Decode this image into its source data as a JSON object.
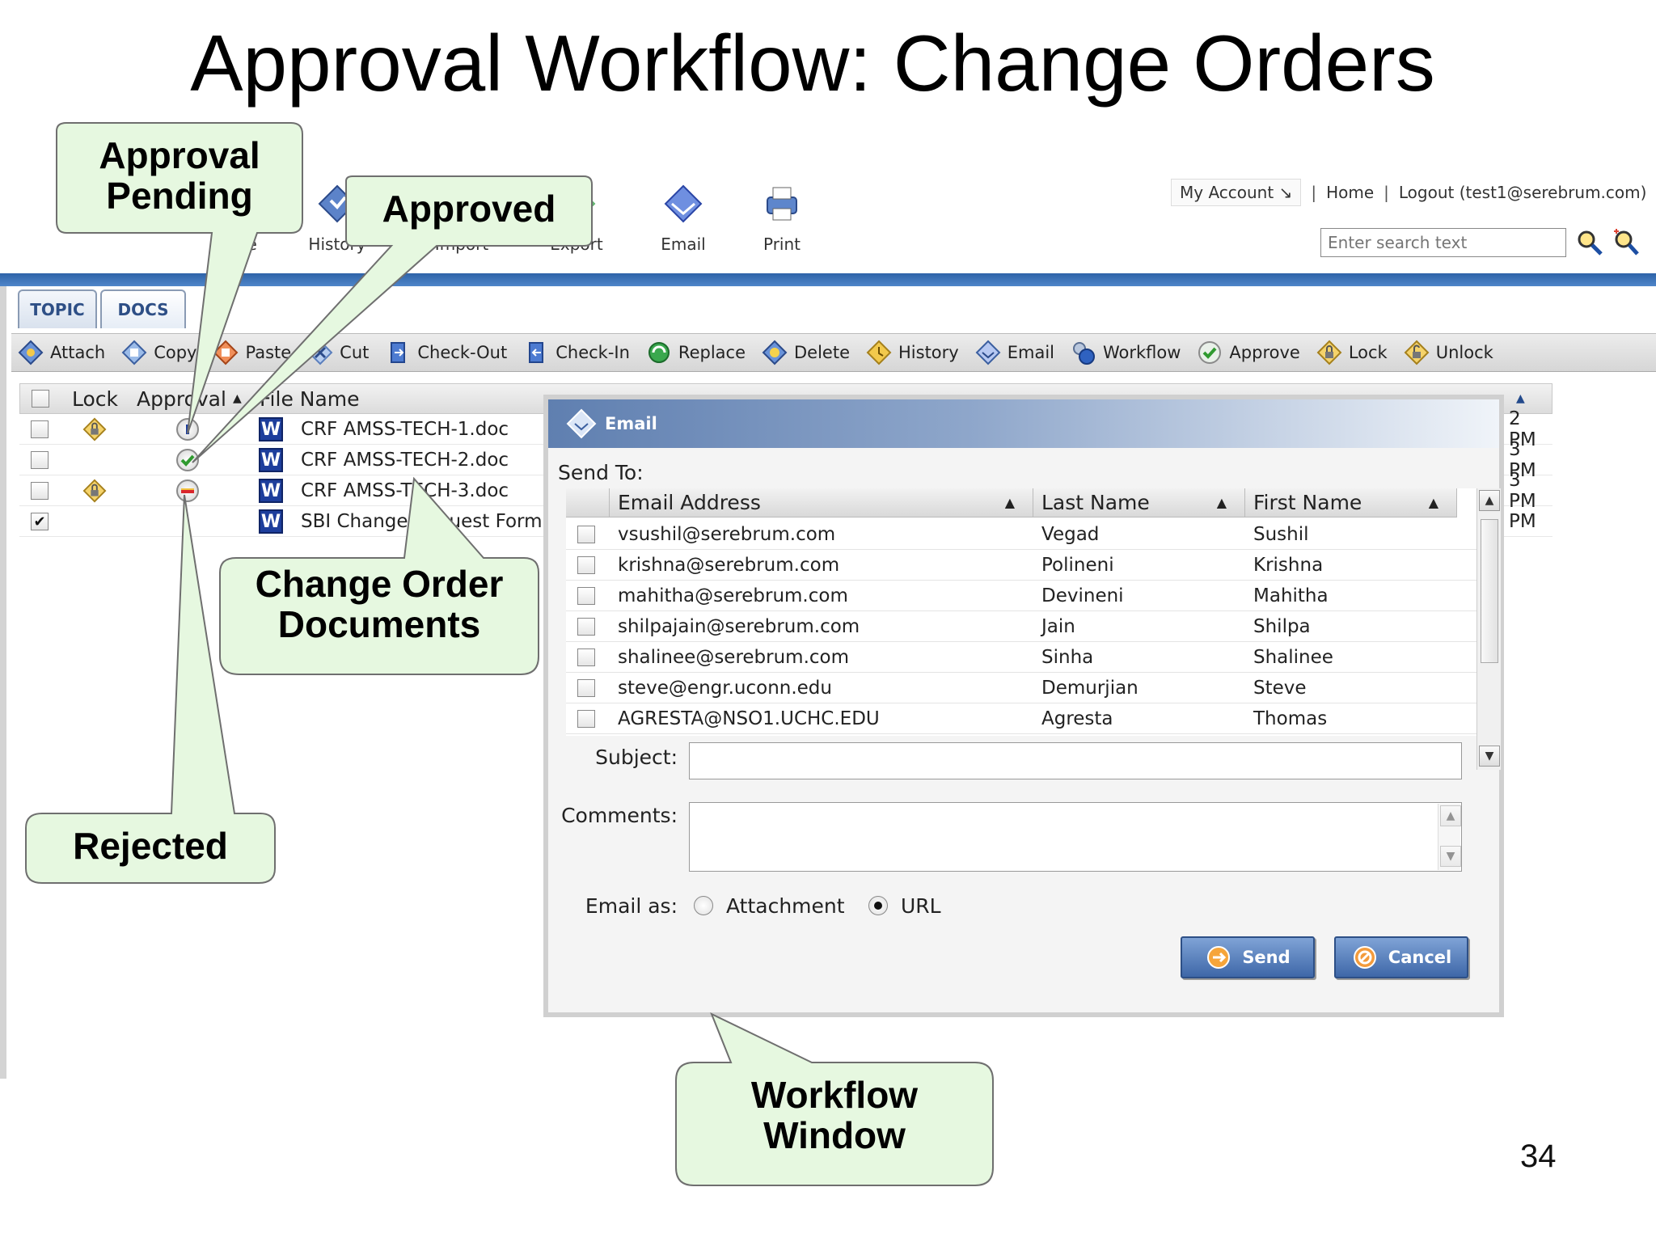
{
  "slide": {
    "title": "Approval Workflow: Change Orders",
    "page_number": "34"
  },
  "top_toolbar": [
    {
      "label": "Hide",
      "icon": "hide-icon"
    },
    {
      "label": "History",
      "icon": "history-icon"
    },
    {
      "label": "Import",
      "icon": "import-icon"
    },
    {
      "label": "Export",
      "icon": "export-icon"
    },
    {
      "label": "Email",
      "icon": "email-icon"
    },
    {
      "label": "Print",
      "icon": "print-icon"
    }
  ],
  "header_links": {
    "my_account": "My Account",
    "home": "Home",
    "logout": "Logout (test1@serebrum.com)"
  },
  "search": {
    "placeholder": "Enter search text"
  },
  "tabs": [
    "TOPIC",
    "DOCS"
  ],
  "doc_toolbar": [
    {
      "label": "Attach",
      "icon": "attach-icon"
    },
    {
      "label": "Copy",
      "icon": "copy-icon"
    },
    {
      "label": "Paste",
      "icon": "paste-icon"
    },
    {
      "label": "Cut",
      "icon": "cut-icon"
    },
    {
      "label": "Check-Out",
      "icon": "check-out-icon"
    },
    {
      "label": "Check-In",
      "icon": "check-in-icon"
    },
    {
      "label": "Replace",
      "icon": "replace-icon"
    },
    {
      "label": "Delete",
      "icon": "delete-icon"
    },
    {
      "label": "History",
      "icon": "history-icon"
    },
    {
      "label": "Email",
      "icon": "email-icon"
    },
    {
      "label": "Workflow",
      "icon": "workflow-icon"
    },
    {
      "label": "Approve",
      "icon": "approve-icon"
    },
    {
      "label": "Lock",
      "icon": "lock-icon"
    },
    {
      "label": "Unlock",
      "icon": "unlock-icon"
    }
  ],
  "doc_table": {
    "headers": {
      "lock": "Lock",
      "approval": "Approval",
      "file_name": "File Name"
    },
    "rows": [
      {
        "checked": false,
        "locked": true,
        "approval": "pending",
        "file_name": "CRF AMSS-TECH-1.doc",
        "time": "2 PM"
      },
      {
        "checked": false,
        "locked": false,
        "approval": "approved",
        "file_name": "CRF AMSS-TECH-2.doc",
        "time": "3 PM"
      },
      {
        "checked": false,
        "locked": true,
        "approval": "rejected",
        "file_name": "CRF AMSS-TECH-3.doc",
        "time": "3 PM"
      },
      {
        "checked": true,
        "locked": false,
        "approval": "none",
        "file_name": "SBI Change Request Form",
        "time": "PM"
      }
    ]
  },
  "email_dialog": {
    "title": "Email",
    "send_to_label": "Send To:",
    "columns": {
      "email": "Email Address",
      "last_name": "Last Name",
      "first_name": "First Name"
    },
    "recipients": [
      {
        "email": "vsushil@serebrum.com",
        "last_name": "Vegad",
        "first_name": "Sushil"
      },
      {
        "email": "krishna@serebrum.com",
        "last_name": "Polineni",
        "first_name": "Krishna"
      },
      {
        "email": "mahitha@serebrum.com",
        "last_name": "Devineni",
        "first_name": "Mahitha"
      },
      {
        "email": "shilpajain@serebrum.com",
        "last_name": "Jain",
        "first_name": "Shilpa"
      },
      {
        "email": "shalinee@serebrum.com",
        "last_name": "Sinha",
        "first_name": "Shalinee"
      },
      {
        "email": "steve@engr.uconn.edu",
        "last_name": "Demurjian",
        "first_name": "Steve"
      },
      {
        "email": "AGRESTA@NSO1.UCHC.EDU",
        "last_name": "Agresta",
        "first_name": "Thomas"
      }
    ],
    "subject_label": "Subject:",
    "subject_value": "",
    "comments_label": "Comments:",
    "comments_value": "",
    "email_as_label": "Email as:",
    "email_as_options": [
      "Attachment",
      "URL"
    ],
    "email_as_selected": "URL",
    "send_label": "Send",
    "cancel_label": "Cancel"
  },
  "callouts": {
    "approval_pending": [
      "Approval",
      "Pending"
    ],
    "approved": "Approved",
    "change_order_documents": [
      "Change Order",
      "Documents"
    ],
    "rejected": "Rejected",
    "workflow_window": [
      "Workflow",
      "Window"
    ]
  },
  "colors": {
    "callout_fill": "#e6f8e0",
    "header_bar_blue": "#2e63a8",
    "dialog_title_blue": "#5f7fb0"
  }
}
